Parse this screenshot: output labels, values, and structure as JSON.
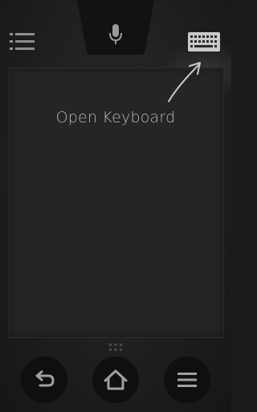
{
  "header": {
    "list_icon": "list-icon",
    "mic_icon": "microphone-icon",
    "keyboard_icon": "keyboard-icon"
  },
  "touchpad": {
    "hint": "Open Keyboard",
    "arrow_icon": "hint-arrow-icon",
    "drag_handle_icon": "drag-handle-icon"
  },
  "nav": {
    "back_icon": "back-icon",
    "home_icon": "home-icon",
    "menu_icon": "menu-icon"
  },
  "colors": {
    "background": "#1b1b1b",
    "pad": "#252525",
    "icon": "#9a9a9a",
    "nav_button": "#0f0f0f"
  }
}
